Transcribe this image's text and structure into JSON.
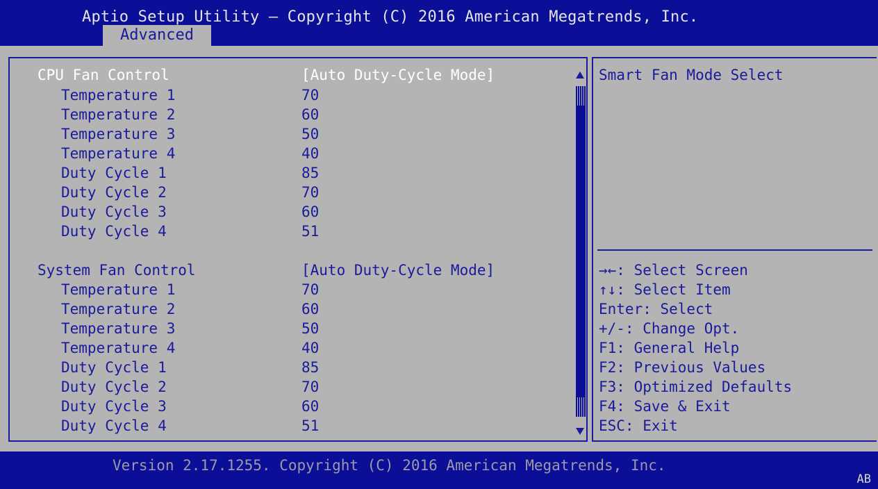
{
  "header": {
    "title": "Aptio Setup Utility – Copyright (C) 2016 American Megatrends, Inc.",
    "active_tab": "Advanced"
  },
  "sections": [
    {
      "label": "CPU Fan Control",
      "value": "[Auto Duty-Cycle Mode]",
      "items": [
        {
          "label": "Temperature 1",
          "value": "70"
        },
        {
          "label": "Temperature 2",
          "value": "60"
        },
        {
          "label": "Temperature 3",
          "value": "50"
        },
        {
          "label": "Temperature 4",
          "value": "40"
        },
        {
          "label": "Duty Cycle 1",
          "value": "85"
        },
        {
          "label": "Duty Cycle 2",
          "value": "70"
        },
        {
          "label": "Duty Cycle 3",
          "value": "60"
        },
        {
          "label": "Duty Cycle 4",
          "value": "51"
        }
      ]
    },
    {
      "label": "System Fan Control",
      "value": "[Auto Duty-Cycle Mode]",
      "items": [
        {
          "label": "Temperature 1",
          "value": "70"
        },
        {
          "label": "Temperature 2",
          "value": "60"
        },
        {
          "label": "Temperature 3",
          "value": "50"
        },
        {
          "label": "Temperature 4",
          "value": "40"
        },
        {
          "label": "Duty Cycle 1",
          "value": "85"
        },
        {
          "label": "Duty Cycle 2",
          "value": "70"
        },
        {
          "label": "Duty Cycle 3",
          "value": "60"
        },
        {
          "label": "Duty Cycle 4",
          "value": "51"
        }
      ]
    }
  ],
  "help": {
    "description": "Smart Fan Mode Select",
    "keys": [
      "→←: Select Screen",
      "↑↓: Select Item",
      "Enter: Select",
      "+/-: Change Opt.",
      "F1: General Help",
      "F2: Previous Values",
      "F3: Optimized Defaults",
      "F4: Save & Exit",
      "ESC: Exit"
    ]
  },
  "footer": {
    "version": "Version 2.17.1255. Copyright (C) 2016 American Megatrends, Inc.",
    "code": "AB"
  },
  "colors": {
    "blue": "#0b0e96",
    "panel_gray": "#b4b4b4",
    "text_blue": "#1a1a9a",
    "selected_text": "#ffffff"
  },
  "icons": {
    "scroll_up": "up-arrow-icon",
    "scroll_down": "down-arrow-icon"
  }
}
